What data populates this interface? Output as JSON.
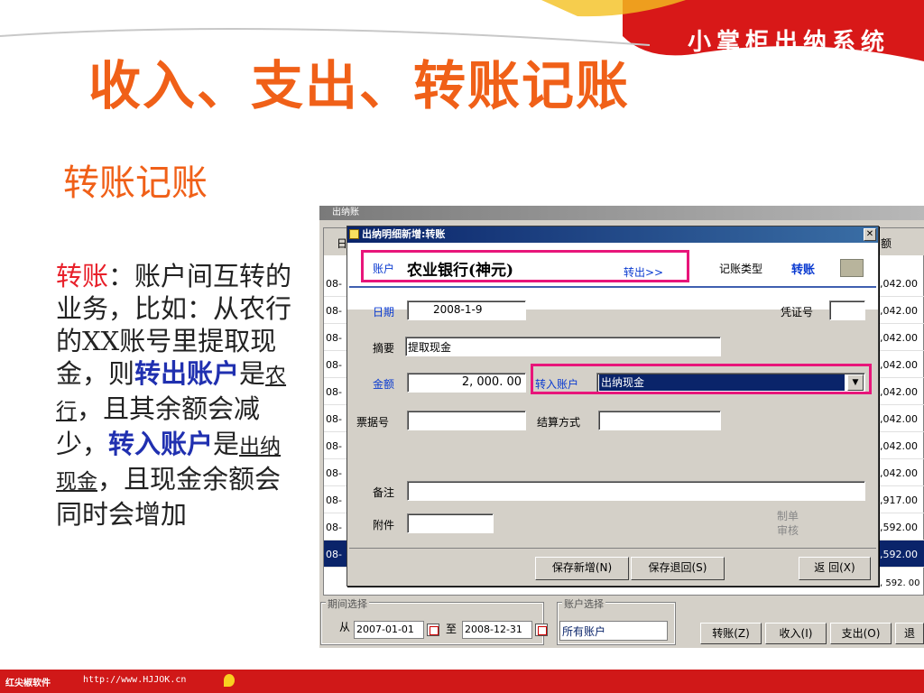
{
  "header": {
    "brand": "小掌柜出纳系统",
    "title": "收入、支出、转账记账",
    "subtitle": "转账记账"
  },
  "description": {
    "term": "转账",
    "colon": "：",
    "line1": "账户间互转的业务，比如：从农行的XX账号里提取现金，则",
    "out_label": "转出账户",
    "is1": "是",
    "out_value": "农行",
    "mid": "，且其余额会减少，",
    "in_label": "转入账户",
    "is2": "是",
    "in_value": "出纳现金",
    "end": "，且现金余额会同时会增加"
  },
  "background_window": {
    "title": "出纳账",
    "column_left": "日",
    "column_right": "额",
    "rows": [
      {
        "date": "08-",
        "amount": ",042.00"
      },
      {
        "date": "08-",
        "amount": ",042.00"
      },
      {
        "date": "08-",
        "amount": ",042.00"
      },
      {
        "date": "08-",
        "amount": ",042.00"
      },
      {
        "date": "08-",
        "amount": ",042.00"
      },
      {
        "date": "08-",
        "amount": ",042.00"
      },
      {
        "date": "08-",
        "amount": ",042.00"
      },
      {
        "date": "08-",
        "amount": ",042.00"
      },
      {
        "date": "08-",
        "amount": ",917.00"
      },
      {
        "date": "08-",
        "amount": ",592.00"
      },
      {
        "date": "08-",
        "amount": ",592.00"
      }
    ],
    "footer_amount": ", 592. 00",
    "period": {
      "legend": "期间选择",
      "from_label": "从",
      "from_value": "2007-01-01",
      "to_label": "至",
      "to_value": "2008-12-31"
    },
    "account": {
      "legend": "账户选择",
      "value": "所有账户"
    },
    "buttons": {
      "transfer": "转账(Z)",
      "income": "收入(I)",
      "expense": "支出(O)",
      "back": "退"
    }
  },
  "dialog": {
    "title": "出纳明细新增:转账",
    "account_label": "账户",
    "account_value": "农业银行(神元)",
    "transfer_out": "转出>>",
    "type_label": "记账类型",
    "type_value": "转账",
    "date_label": "日期",
    "date_value": "2008-1-9",
    "voucher_label": "凭证号",
    "voucher_value": "",
    "summary_label": "摘要",
    "summary_value": "提取现金",
    "amount_label": "金额",
    "amount_value": "2, 000. 00",
    "in_account_label": "转入账户",
    "in_account_value": "出纳现金",
    "bill_label": "票据号",
    "bill_value": "",
    "settle_label": "结算方式",
    "settle_value": "",
    "note_label": "备注",
    "note_value": "",
    "attach_label": "附件",
    "attach_value": "",
    "maker_label": "制单",
    "review_label": "审核",
    "buttons": {
      "save_new": "保存新增(N)",
      "save_back": "保存退回(S)",
      "back": "返 回(X)"
    }
  },
  "footer": {
    "company": "红尖椒软件",
    "url": "http://www.HJJOK.cn"
  },
  "colors": {
    "title_orange": "#f06018",
    "highlight_pink": "#e8157a",
    "banner_red": "#d81818"
  }
}
